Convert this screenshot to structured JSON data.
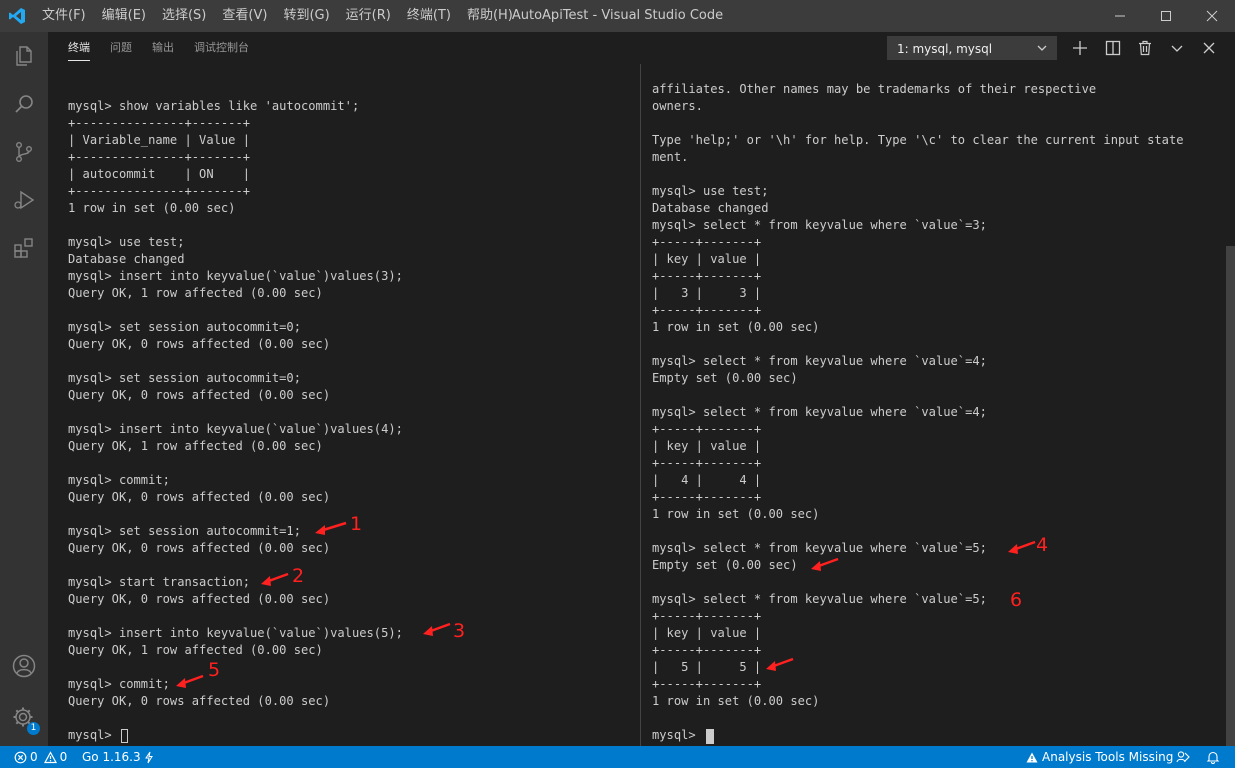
{
  "window": {
    "title": "AutoApiTest - Visual Studio Code"
  },
  "menu": [
    "文件(F)",
    "编辑(E)",
    "选择(S)",
    "查看(V)",
    "转到(G)",
    "运行(R)",
    "终端(T)",
    "帮助(H)"
  ],
  "panel": {
    "tabs": [
      "终端",
      "问题",
      "输出",
      "调试控制台"
    ],
    "active_tab": "终端",
    "terminal_select": "1: mysql, mysql"
  },
  "terminal_left": {
    "lines": [
      "mysql> show variables like 'autocommit';",
      "+---------------+-------+",
      "| Variable_name | Value |",
      "+---------------+-------+",
      "| autocommit    | ON    |",
      "+---------------+-------+",
      "1 row in set (0.00 sec)",
      "",
      "mysql> use test;",
      "Database changed",
      "mysql> insert into keyvalue(`value`)values(3);",
      "Query OK, 1 row affected (0.00 sec)",
      "",
      "mysql> set session autocommit=0;",
      "Query OK, 0 rows affected (0.00 sec)",
      "",
      "mysql> set session autocommit=0;",
      "Query OK, 0 rows affected (0.00 sec)",
      "",
      "mysql> insert into keyvalue(`value`)values(4);",
      "Query OK, 1 row affected (0.00 sec)",
      "",
      "mysql> commit;",
      "Query OK, 0 rows affected (0.00 sec)",
      "",
      "mysql> set session autocommit=1;",
      "Query OK, 0 rows affected (0.00 sec)",
      "",
      "mysql> start transaction;",
      "Query OK, 0 rows affected (0.00 sec)",
      "",
      "mysql> insert into keyvalue(`value`)values(5);",
      "Query OK, 1 row affected (0.00 sec)",
      "",
      "mysql> commit;",
      "Query OK, 0 rows affected (0.00 sec)",
      "",
      "mysql> "
    ]
  },
  "terminal_right": {
    "lines": [
      "affiliates. Other names may be trademarks of their respective",
      "owners.",
      "",
      "Type 'help;' or '\\h' for help. Type '\\c' to clear the current input state",
      "ment.",
      "",
      "mysql> use test;",
      "Database changed",
      "mysql> select * from keyvalue where `value`=3;",
      "+-----+-------+",
      "| key | value |",
      "+-----+-------+",
      "|   3 |     3 |",
      "+-----+-------+",
      "1 row in set (0.00 sec)",
      "",
      "mysql> select * from keyvalue where `value`=4;",
      "Empty set (0.00 sec)",
      "",
      "mysql> select * from keyvalue where `value`=4;",
      "+-----+-------+",
      "| key | value |",
      "+-----+-------+",
      "|   4 |     4 |",
      "+-----+-------+",
      "1 row in set (0.00 sec)",
      "",
      "mysql> select * from keyvalue where `value`=5;",
      "Empty set (0.00 sec)",
      "",
      "mysql> select * from keyvalue where `value`=5;",
      "+-----+-------+",
      "| key | value |",
      "+-----+-------+",
      "|   5 |     5 |",
      "+-----+-------+",
      "1 row in set (0.00 sec)",
      "",
      "mysql> "
    ]
  },
  "annotations": [
    "1",
    "2",
    "3",
    "5",
    "4",
    "6"
  ],
  "statusbar": {
    "errors": "0",
    "warnings": "0",
    "go_version": "Go 1.16.3",
    "analysis": "Analysis Tools Missing",
    "settings_badge": "1"
  },
  "colors": {
    "accent": "#007acc",
    "annotation": "#ff2020"
  }
}
